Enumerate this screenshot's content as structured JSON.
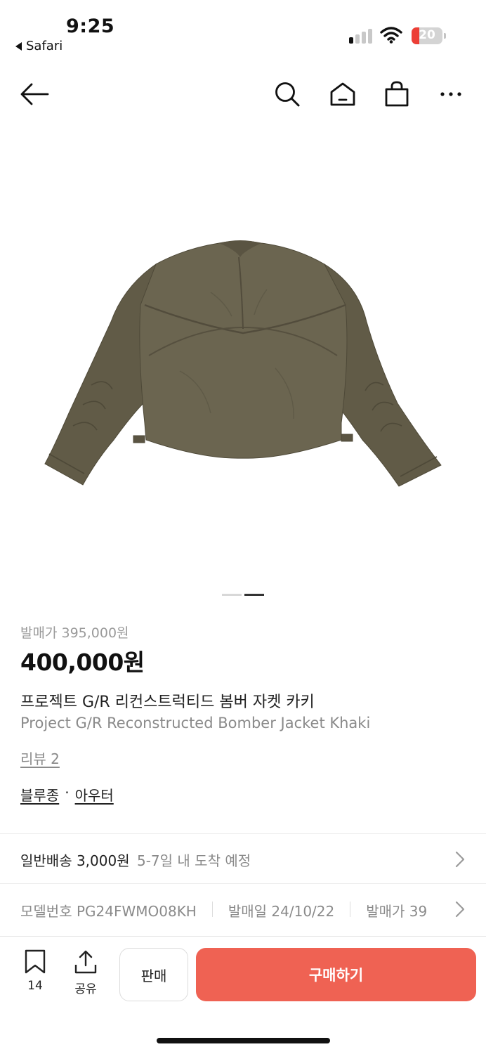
{
  "status_bar": {
    "time": "9:25",
    "back_app": "Safari",
    "battery_level": "20",
    "signal_bars_active": 1,
    "signal_bars_total": 4
  },
  "nav": {
    "icons": [
      "back-arrow-icon",
      "search-icon",
      "home-icon",
      "shopping-bag-icon",
      "more-icon"
    ]
  },
  "product": {
    "image_pager": {
      "count": 2,
      "active_index": 1
    },
    "release_price": "발매가 395,000원",
    "price": "400,000원",
    "title_ko": "프로젝트 G/R 리컨스트럭티드 봄버 자켓 카키",
    "title_en": "Project G/R Reconstructed Bomber Jacket Khaki",
    "review_link": "리뷰 2",
    "categories": [
      "블루종",
      "아우터"
    ],
    "category_separator": "·"
  },
  "shipping": {
    "label": "일반배송 3,000원",
    "eta": "5-7일 내 도착 예정"
  },
  "info": {
    "model": "모델번호 PG24FWMO08KH",
    "release_date": "발매일 24/10/22",
    "release_price_cut": "발매가 39"
  },
  "bottom_bar": {
    "bookmark_count": "14",
    "share_label": "공유",
    "sell_label": "판매",
    "buy_label": "구매하기"
  },
  "colors": {
    "accent": "#ef6253",
    "jacket": "#6b6550",
    "battery_low": "#ec3f36"
  }
}
